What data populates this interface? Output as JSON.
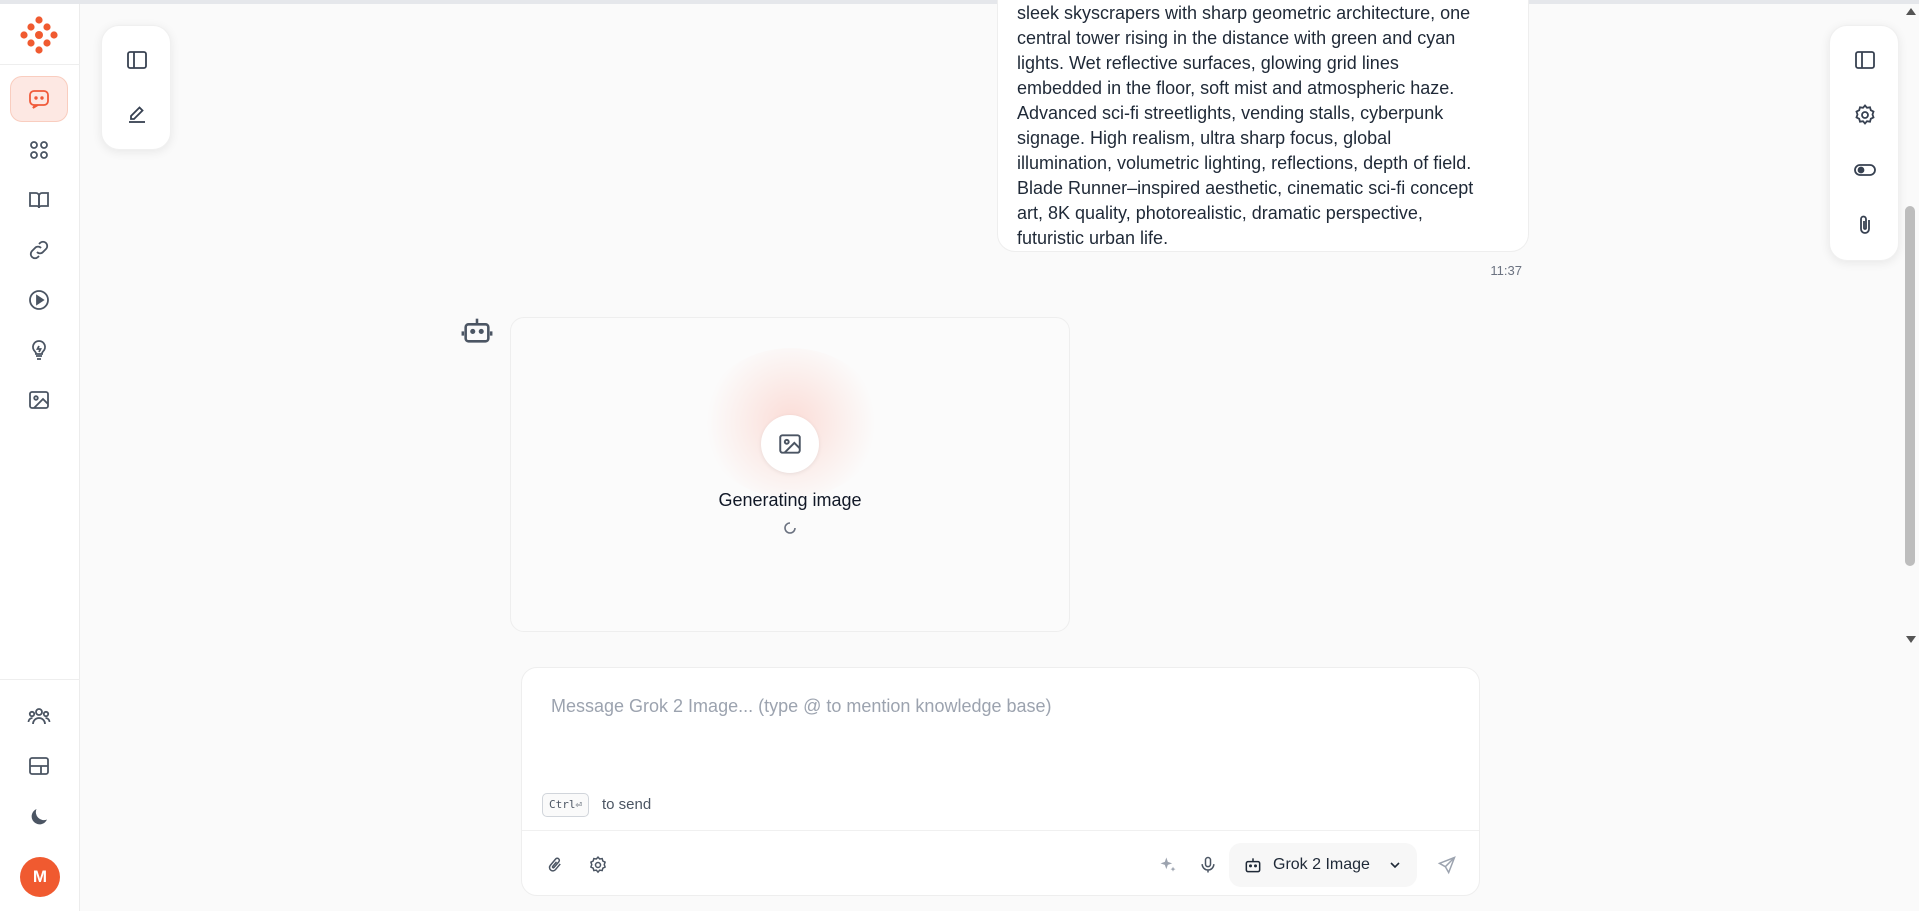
{
  "app": {
    "accent": "#f05a30",
    "sidebar": {
      "nav_items": [
        {
          "name": "chat",
          "icon": "chat-bubble-icon",
          "active": true
        },
        {
          "name": "apps",
          "icon": "apps-grid-icon",
          "active": false
        },
        {
          "name": "knowledge",
          "icon": "book-icon",
          "active": false
        },
        {
          "name": "integrations",
          "icon": "link-icon",
          "active": false
        },
        {
          "name": "media",
          "icon": "play-icon",
          "active": false
        },
        {
          "name": "prompts",
          "icon": "lightbulb-icon",
          "active": false
        },
        {
          "name": "images",
          "icon": "image-icon",
          "active": false
        }
      ],
      "bottom_items": [
        {
          "name": "team",
          "icon": "users-icon"
        },
        {
          "name": "workspace",
          "icon": "layout-icon"
        },
        {
          "name": "theme",
          "icon": "moon-icon"
        }
      ],
      "avatar_initial": "M"
    },
    "left_panel": {
      "buttons": [
        "sidebar-toggle-icon",
        "new-chat-pencil-icon"
      ]
    },
    "right_panel": {
      "buttons": [
        "panel-toggle-icon",
        "settings-gear-icon",
        "toggle-switch-icon",
        "paperclip-icon"
      ]
    }
  },
  "conversation": {
    "user_message": {
      "lines": [
        "sleek skyscrapers with sharp geometric architecture, one",
        "central tower rising in the distance with green and cyan",
        "lights. Wet reflective surfaces, glowing grid lines",
        "embedded in the floor, soft mist and atmospheric haze.",
        "Advanced sci-fi streetlights, vending stalls, cyberpunk",
        "signage. High realism, ultra sharp focus, global",
        "illumination, volumetric lighting, reflections, depth of field.",
        "Blade Runner–inspired aesthetic, cinematic sci-fi concept",
        "art, 8K quality, photorealistic, dramatic perspective,",
        "futuristic urban life."
      ],
      "time": "11:37"
    },
    "bot_response": {
      "status": "Generating image"
    }
  },
  "composer": {
    "placeholder": "Message Grok 2 Image... (type @ to mention knowledge base)",
    "shortcut_key": "Ctrl⏎",
    "shortcut_hint": "to send",
    "model": "Grok 2 Image"
  }
}
